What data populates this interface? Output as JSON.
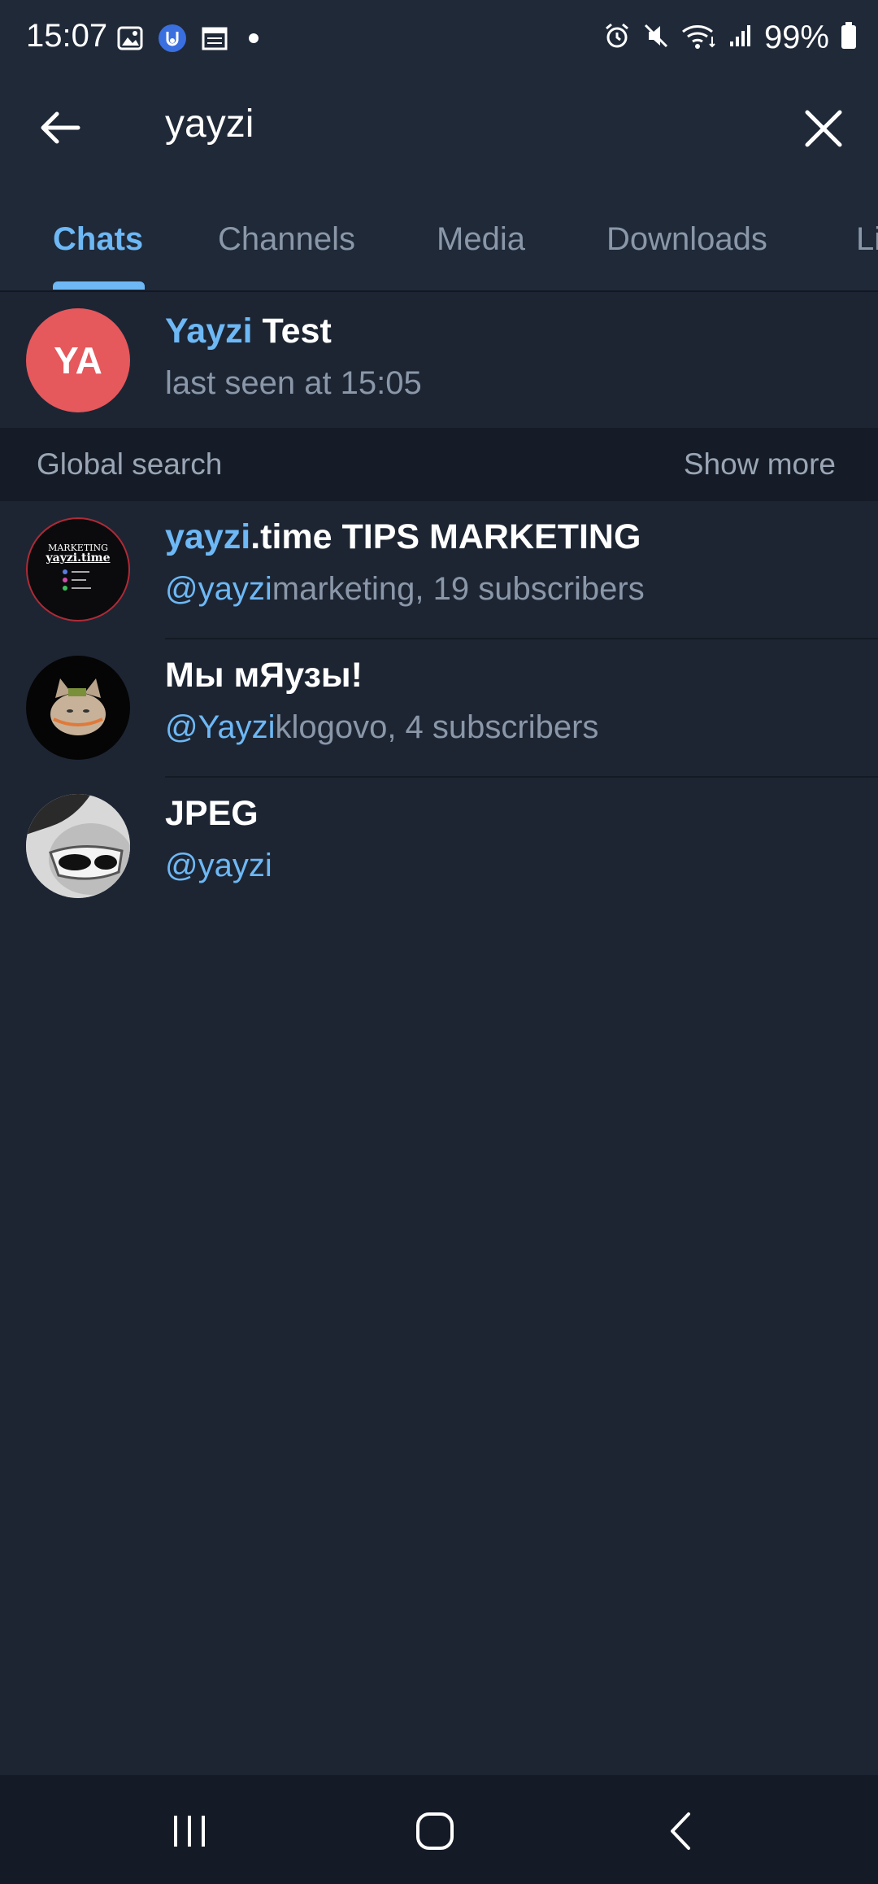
{
  "status_bar": {
    "time": "15:07",
    "left_icons": [
      "gallery-icon",
      "app-icon",
      "calendar-icon",
      "dot-icon"
    ],
    "right_icons": [
      "alarm-icon",
      "mute-icon",
      "wifi-icon",
      "signal-icon",
      "battery-icon"
    ],
    "battery_percent": "99%"
  },
  "search": {
    "query": "yayzi"
  },
  "tabs": [
    {
      "label": "Chats",
      "active": true
    },
    {
      "label": "Channels",
      "active": false
    },
    {
      "label": "Media",
      "active": false
    },
    {
      "label": "Downloads",
      "active": false
    },
    {
      "label": "Li",
      "active": false
    }
  ],
  "chat_results": [
    {
      "avatar_initials": "YA",
      "avatar_color": "#e5585c",
      "title_highlight": "Yayzi",
      "title_rest": " Test",
      "subtitle": "last seen at 15:05"
    }
  ],
  "global_search": {
    "label": "Global search",
    "show_more": "Show more",
    "results": [
      {
        "avatar": "marketing-logo",
        "avatar_text_1": "MARKETING",
        "avatar_text_2": "yayzi.time",
        "title_highlight": "yayzi",
        "title_rest": ".time TIPS MARKETING",
        "sub_highlight": "@yayzi",
        "sub_rest": "marketing, 19 subscribers"
      },
      {
        "avatar": "cat-picture",
        "title_highlight": "",
        "title_rest": "Мы мЯузы!",
        "sub_highlight": "@Yayzi",
        "sub_rest": "klogovo, 4 subscribers"
      },
      {
        "avatar": "person-sunglasses-photo",
        "title_highlight": "",
        "title_rest": "JPEG",
        "sub_highlight": "@yayzi",
        "sub_rest": ""
      }
    ]
  },
  "colors": {
    "accent": "#6db8f5",
    "background": "#1d2533",
    "header": "#1f2938"
  }
}
